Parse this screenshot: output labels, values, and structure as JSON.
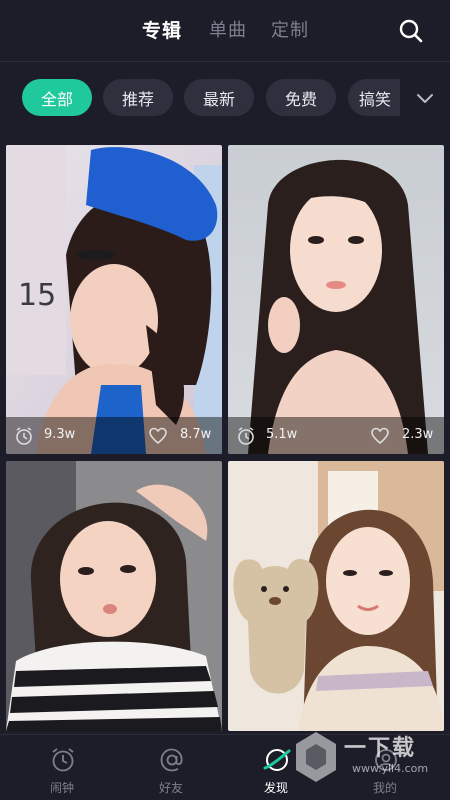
{
  "header": {
    "tabs": [
      {
        "label": "专辑",
        "active": true
      },
      {
        "label": "单曲",
        "active": false
      },
      {
        "label": "定制",
        "active": false
      }
    ],
    "search_icon": "search-icon"
  },
  "filters": {
    "chips": [
      {
        "label": "全部",
        "active": true
      },
      {
        "label": "推荐",
        "active": false
      },
      {
        "label": "最新",
        "active": false
      },
      {
        "label": "免费",
        "active": false
      },
      {
        "label": "搞笑",
        "active": false
      }
    ],
    "expand_icon": "chevron-down-icon"
  },
  "albums": [
    {
      "plays": "9.3w",
      "likes": "8.7w"
    },
    {
      "plays": "5.1w",
      "likes": "2.3w"
    },
    {
      "plays": "",
      "likes": ""
    },
    {
      "plays": "",
      "likes": ""
    }
  ],
  "bottom_nav": [
    {
      "label": "闹钟",
      "icon": "alarm-clock-icon",
      "active": false
    },
    {
      "label": "好友",
      "icon": "at-sign-icon",
      "active": false
    },
    {
      "label": "发现",
      "icon": "discover-planet-icon",
      "active": true
    },
    {
      "label": "我的",
      "icon": "profile-icon",
      "active": false
    }
  ],
  "watermark": {
    "text": "一下载",
    "url": "www.yll4.com"
  },
  "colors": {
    "background": "#1c1d29",
    "accent": "#1fc99b",
    "chip": "#2f303e",
    "inactive_text": "#7d7f8e"
  }
}
